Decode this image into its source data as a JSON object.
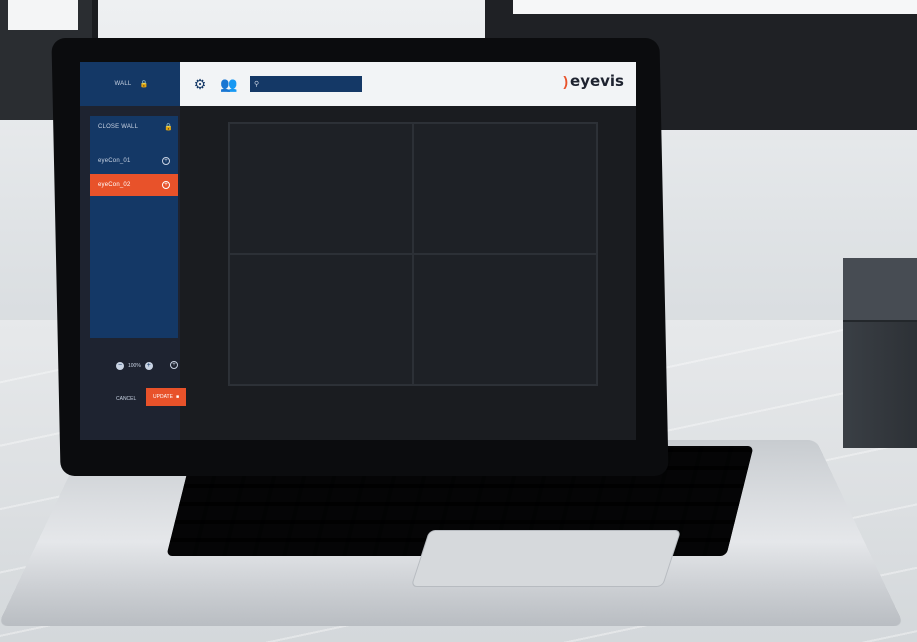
{
  "app": {
    "sidebar_title": "WALL",
    "close_wall": "CLOSE WALL",
    "items": [
      {
        "label": "eyeCon_01",
        "active": false
      },
      {
        "label": "eyeCon_02",
        "active": true
      }
    ],
    "zoom": "100%",
    "cancel_label": "CANCEL",
    "update_label": "UPDATE",
    "search_placeholder": "",
    "brand_mark": ")",
    "brand_name": "eyevis",
    "colors": {
      "accent": "#e8522a",
      "sidebar": "#143866",
      "topbar": "#f2f4f6"
    },
    "icons": {
      "top": [
        "gear-icon",
        "users-icon"
      ],
      "search": "search-icon"
    }
  }
}
